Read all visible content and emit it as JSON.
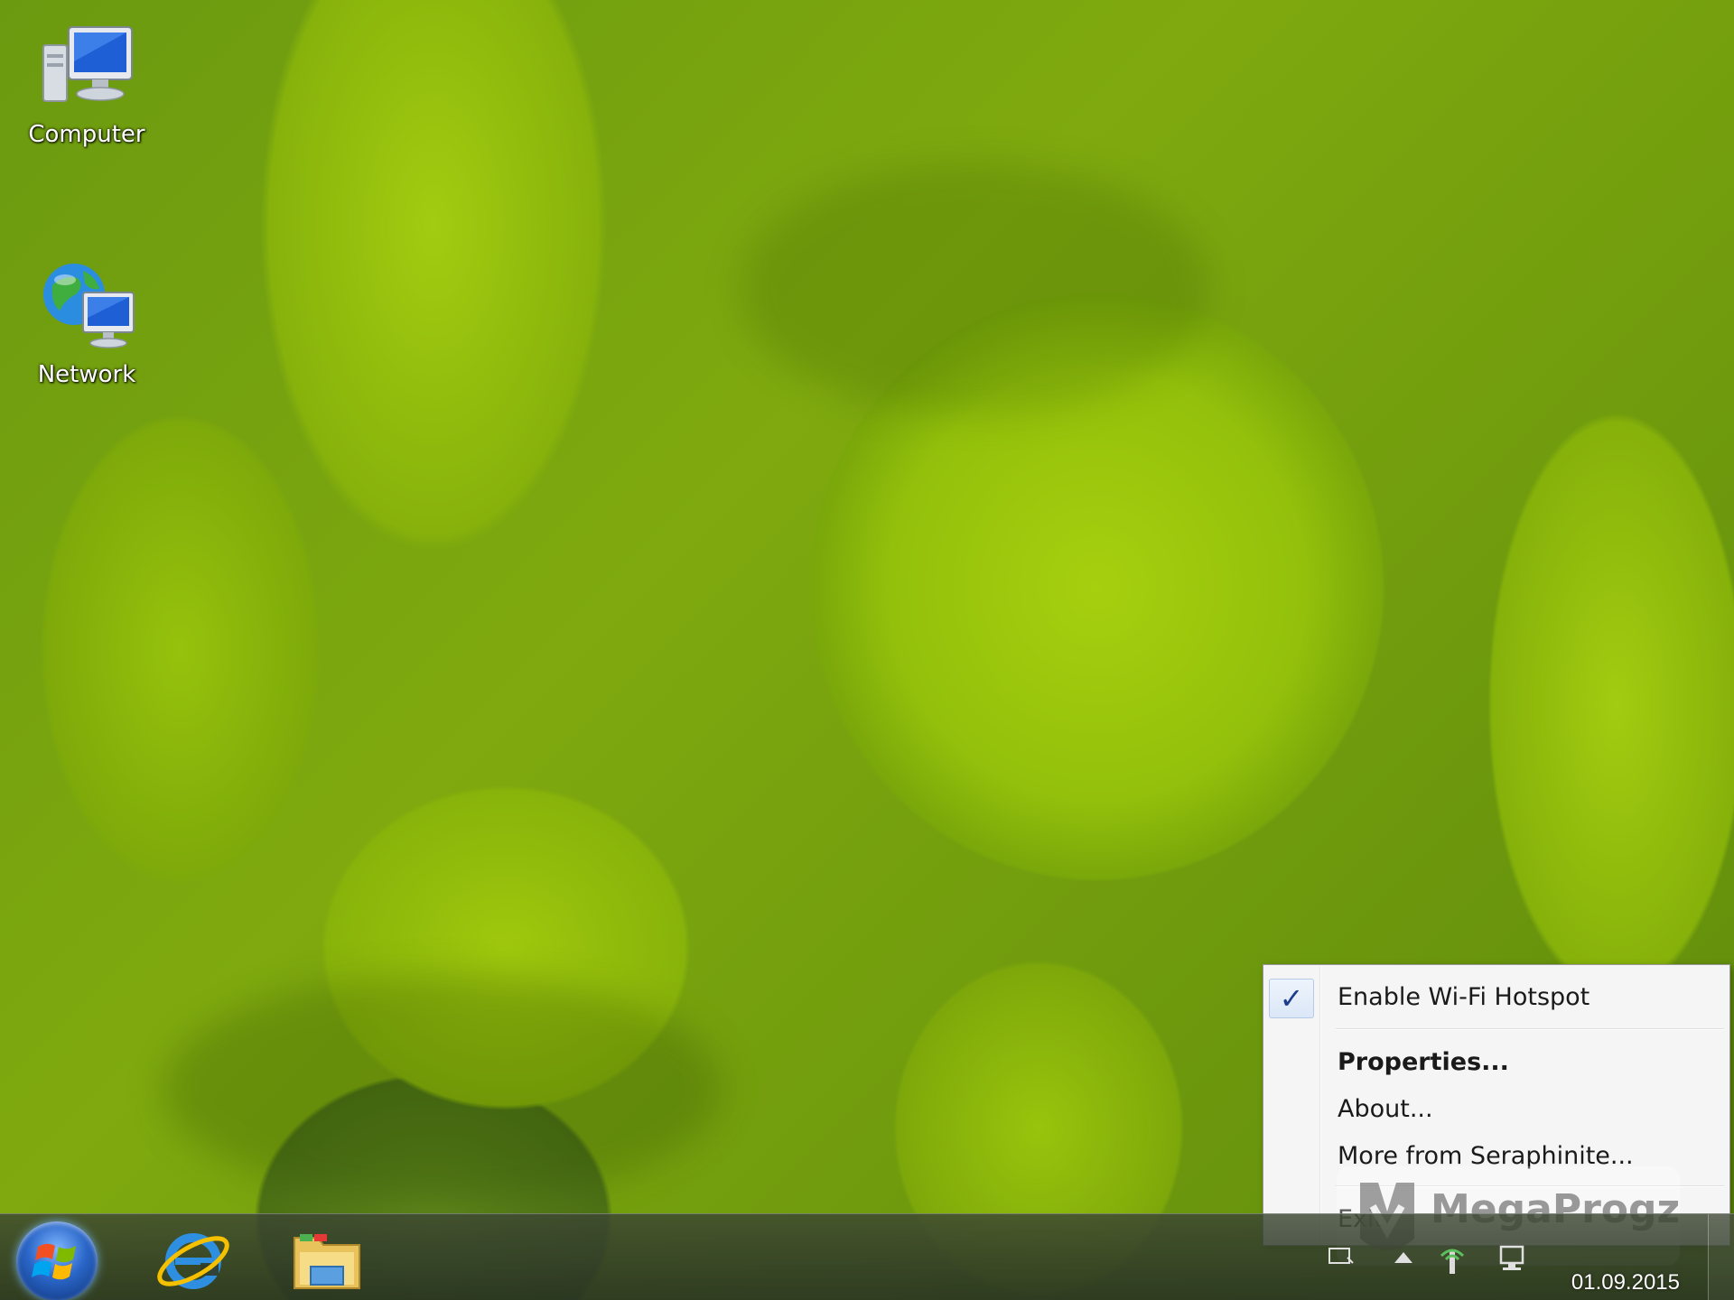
{
  "desktop": {
    "icons": [
      {
        "label": "Computer",
        "icon": "computer-icon"
      },
      {
        "label": "Network",
        "icon": "network-icon"
      }
    ]
  },
  "context_menu": {
    "items": [
      {
        "label": "Enable Wi-Fi Hotspot",
        "checked": true
      },
      {
        "label": "Properties...",
        "bold": true
      },
      {
        "label": "About..."
      },
      {
        "label": "More from Seraphinite..."
      },
      {
        "label": "Exit"
      }
    ]
  },
  "taskbar": {
    "pinned": [
      "start-orb-icon",
      "internet-explorer-icon",
      "file-explorer-icon"
    ],
    "tray_icons": [
      "action-center-icon",
      "show-hidden-icons-icon",
      "wifi-hotspot-icon",
      "network-icon"
    ],
    "clock_date": "01.09.2015"
  },
  "watermark": {
    "text": "MegaProgz"
  },
  "colors": {
    "menu_bg": "#f5f5f5",
    "check_color": "#1c3c8c",
    "wallpaper_green": "#93c00b"
  }
}
